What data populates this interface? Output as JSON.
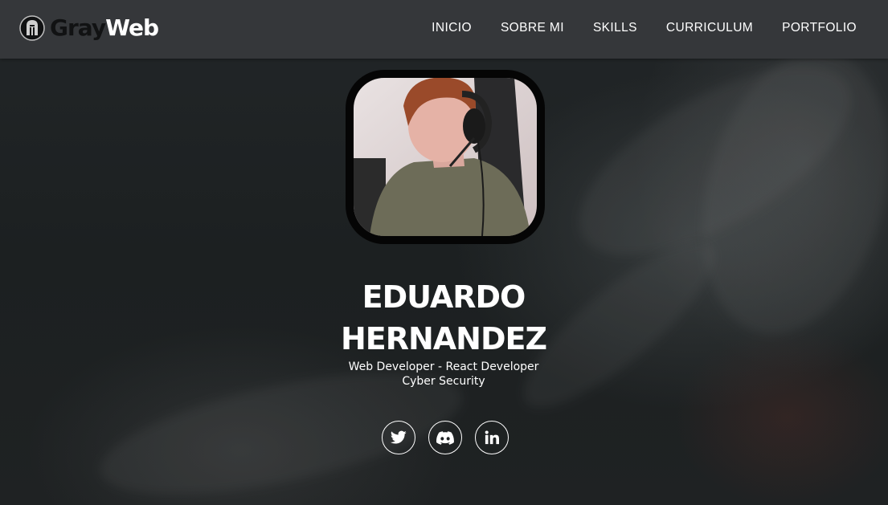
{
  "brand": {
    "name_dark": "Gray",
    "name_light": "Web",
    "icon": "spartan-helmet-icon"
  },
  "nav": {
    "items": [
      {
        "label": "INICIO"
      },
      {
        "label": "SOBRE MI"
      },
      {
        "label": "SKILLS"
      },
      {
        "label": "CURRICULUM"
      },
      {
        "label": "PORTFOLIO"
      }
    ]
  },
  "profile": {
    "name_line1": "EDUARDO",
    "name_line2": "HERNANDEZ",
    "role_line1": "Web Developer - React Developer",
    "role_line2": "Cyber Security",
    "photo": "profile-photo"
  },
  "socials": [
    {
      "icon": "twitter-icon"
    },
    {
      "icon": "discord-icon"
    },
    {
      "icon": "linkedin-icon"
    }
  ],
  "colors": {
    "navbar": "#35373a",
    "background": "#1c2021",
    "text": "#ffffff",
    "logo_dark": "#111213"
  }
}
